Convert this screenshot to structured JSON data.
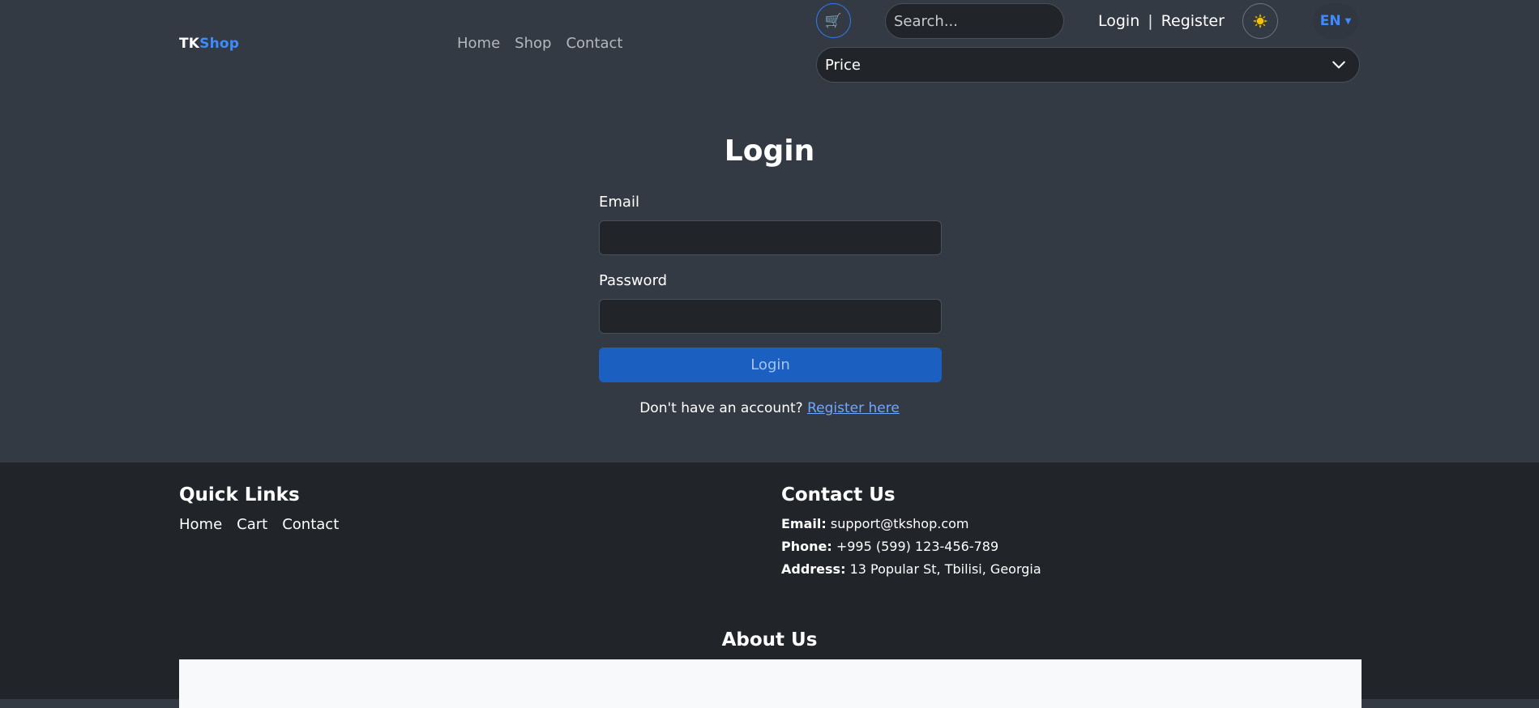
{
  "header": {
    "brand_tk": "TK",
    "brand_shop": "Shop",
    "nav": [
      "Home",
      "Shop",
      "Contact"
    ],
    "cart_icon": "cart-icon",
    "search_placeholder": "Search...",
    "login_label": "Login",
    "separator": "|",
    "register_label": "Register",
    "theme_icon": "sun-icon",
    "lang_label": "EN",
    "price_select_value": "Price"
  },
  "login_form": {
    "title": "Login",
    "email_label": "Email",
    "password_label": "Password",
    "submit_label": "Login",
    "no_account_text": "Don't have an account?",
    "register_link": "Register here"
  },
  "footer": {
    "quick_links_title": "Quick Links",
    "quick_links": [
      "Home",
      "Cart",
      "Contact"
    ],
    "contact_title": "Contact Us",
    "email_key": "Email:",
    "email_value": "support@tkshop.com",
    "phone_key": "Phone:",
    "phone_value": "+995 (599) 123-456-789",
    "address_key": "Address:",
    "address_value": "13 Popular St, Tbilisi, Georgia",
    "about_title": "About Us"
  },
  "colors": {
    "background": "#343a43",
    "footer_bg": "#212529",
    "accent": "#3d8bfd",
    "button": "#1b5fc1"
  }
}
